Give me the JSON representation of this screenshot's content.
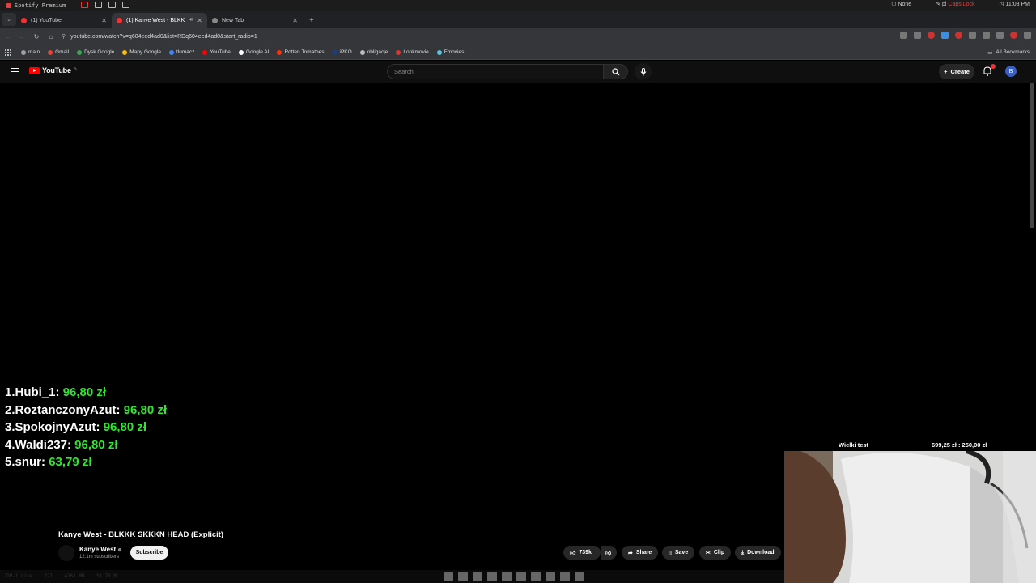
{
  "os_bar": {
    "app_name": "Spotify Premium",
    "status_none": "None",
    "keyboard_layout": "pl",
    "caps_lock": "Caps Lock",
    "time": "11:03 PM"
  },
  "tabs": [
    {
      "label": "(1) YouTube",
      "active": false
    },
    {
      "label": "(1) Kanye West - BLKKK",
      "active": true
    },
    {
      "label": "New Tab",
      "active": false
    }
  ],
  "address": {
    "url": "youtube.com/watch?v=q604eed4ad0&list=RDq604eed4ad0&start_radio=1"
  },
  "bookmarks": [
    {
      "label": "main",
      "icon": "folder-icon",
      "color": "#9aa0a6"
    },
    {
      "label": "Gmail",
      "icon": "gmail-icon",
      "color": "#ea4335"
    },
    {
      "label": "Dysk Google",
      "icon": "google-drive-icon",
      "color": "#34a853"
    },
    {
      "label": "Mapy Google",
      "icon": "google-maps-icon",
      "color": "#fbbc04"
    },
    {
      "label": "tlumacz",
      "icon": "translate-icon",
      "color": "#4285f4"
    },
    {
      "label": "YouTube",
      "icon": "youtube-icon",
      "color": "#ff0000"
    },
    {
      "label": "Google AI",
      "icon": "google-ai-icon",
      "color": "#ffffff"
    },
    {
      "label": "Rotten Tomatoes",
      "icon": "tomato-icon",
      "color": "#fa320a"
    },
    {
      "label": "iPKO",
      "icon": "pko-icon",
      "color": "#1a3c8c"
    },
    {
      "label": "obligacje",
      "icon": "bonds-icon",
      "color": "#bbbbbb"
    },
    {
      "label": "Lookmovie",
      "icon": "lookmovie-icon",
      "color": "#e33333"
    },
    {
      "label": "Fmovies",
      "icon": "fmovies-icon",
      "color": "#58c4dc"
    }
  ],
  "all_bookmarks": "All Bookmarks",
  "youtube": {
    "logo_text": "YouTube",
    "logo_region": "PL",
    "search_placeholder": "Search",
    "create_label": "Create",
    "avatar_letter": "B"
  },
  "leaderboard": [
    {
      "rank": "1.",
      "name": "Hubi_1:",
      "amount": "96,80 zł"
    },
    {
      "rank": "2.",
      "name": "RoztanczonyAzut:",
      "amount": "96,80 zł"
    },
    {
      "rank": "3.",
      "name": "SpokojnyAzut:",
      "amount": "96,80 zł"
    },
    {
      "rank": "4.",
      "name": "Waldi237:",
      "amount": "96,80 zł"
    },
    {
      "rank": "5.",
      "name": "snur:",
      "amount": "63,79 zł"
    }
  ],
  "goal": {
    "label": "Wielki test",
    "value": "699,25 zł : 250,00 zł"
  },
  "video": {
    "title": "Kanye West - BLKKK SKKKN HEAD (Explicit)",
    "channel": "Kanye West",
    "subscribers": "12.1m subscribers",
    "subscribe_label": "Subscribe",
    "likes": "739k",
    "share_label": "Share",
    "save_label": "Save",
    "clip_label": "Clip",
    "download_label": "Download"
  },
  "taskbar": {
    "items": [
      "DP-1 Live",
      "221",
      "4161 MB",
      "38.78 M"
    ]
  },
  "colors": {
    "leaderboard_amount": "#2ee82e",
    "youtube_red": "#ff0000",
    "caps_lock": "#e04040"
  }
}
